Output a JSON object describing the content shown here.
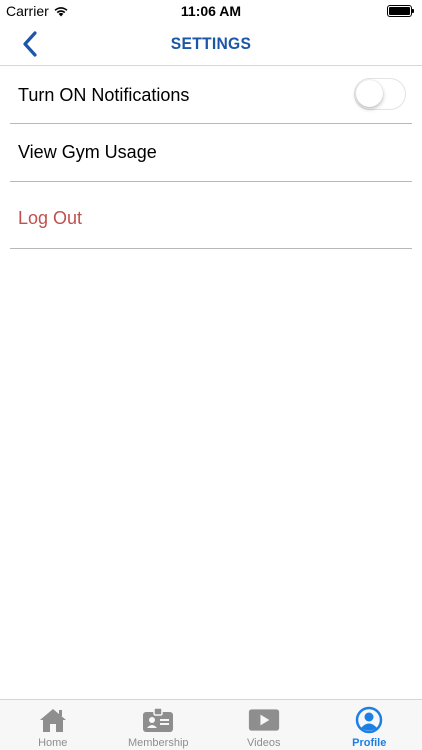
{
  "status_bar": {
    "carrier": "Carrier",
    "time": "11:06 AM"
  },
  "nav": {
    "title": "SETTINGS",
    "back_icon": "chevron-left-icon"
  },
  "settings": {
    "notifications_label": "Turn ON Notifications",
    "notifications_enabled": false,
    "gym_usage_label": "View Gym Usage",
    "logout_label": "Log Out"
  },
  "tabs": [
    {
      "label": "Home",
      "icon": "home-icon",
      "active": false
    },
    {
      "label": "Membership",
      "icon": "id-card-icon",
      "active": false
    },
    {
      "label": "Videos",
      "icon": "play-icon",
      "active": false
    },
    {
      "label": "Profile",
      "icon": "profile-icon",
      "active": true
    }
  ],
  "colors": {
    "accent": "#1c56a6",
    "logout": "#c0504d",
    "tab_active": "#1c7fe6",
    "tab_inactive": "#8e8e8e"
  }
}
